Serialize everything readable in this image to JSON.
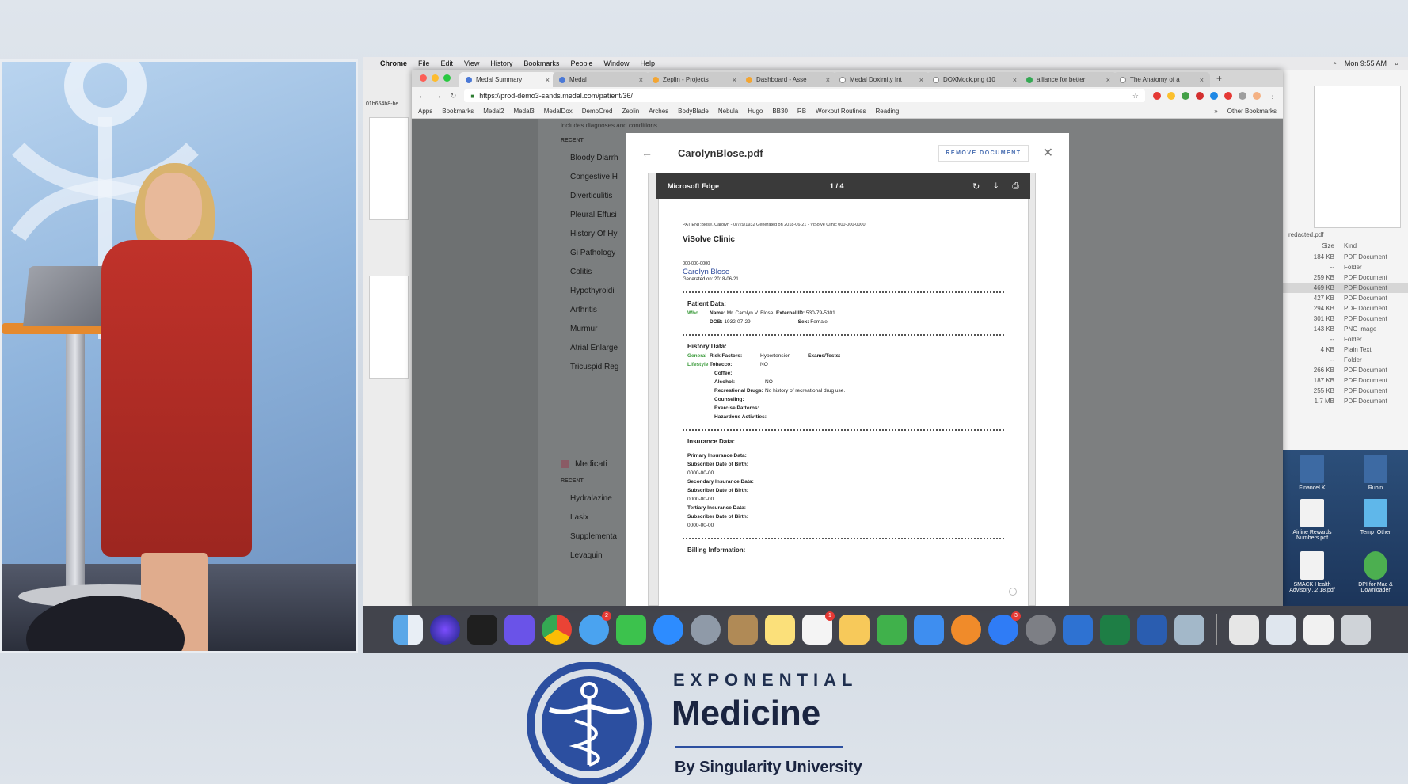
{
  "menubar": {
    "apple": "",
    "items": [
      "Chrome",
      "File",
      "Edit",
      "View",
      "History",
      "Bookmarks",
      "People",
      "Window",
      "Help"
    ],
    "clock": "Mon 9:55 AM"
  },
  "finder": {
    "left_label": "01b654b8-be",
    "preview_caption": "redacted.pdf",
    "rows": [
      {
        "size": "184 KB",
        "kind": "PDF Document"
      },
      {
        "size": "--",
        "kind": "Folder"
      },
      {
        "size": "259 KB",
        "kind": "PDF Document"
      },
      {
        "size": "469 KB",
        "kind": "PDF Document"
      },
      {
        "size": "427 KB",
        "kind": "PDF Document"
      },
      {
        "size": "294 KB",
        "kind": "PDF Document"
      },
      {
        "size": "301 KB",
        "kind": "PDF Document"
      },
      {
        "size": "143 KB",
        "kind": "PNG image"
      },
      {
        "size": "--",
        "kind": "Folder"
      },
      {
        "size": "4 KB",
        "kind": "Plain Text"
      },
      {
        "size": "--",
        "kind": "Folder"
      },
      {
        "size": "266 KB",
        "kind": "PDF Document"
      },
      {
        "size": "187 KB",
        "kind": "PDF Document"
      },
      {
        "size": "255 KB",
        "kind": "PDF Document"
      },
      {
        "size": "1.7 MB",
        "kind": "PDF Document"
      }
    ],
    "col_size": "Size",
    "col_kind": "Kind"
  },
  "desktop": {
    "icons": [
      {
        "label": "FinanceLK"
      },
      {
        "label": "Rubin"
      },
      {
        "label": "Airline Rewards Numbers.pdf"
      },
      {
        "label": "Temp_Other"
      },
      {
        "label": "SMACK Health Advisory...2.18.pdf"
      },
      {
        "label": "DPI for Mac & Downloader"
      }
    ]
  },
  "chrome": {
    "tabs": [
      {
        "label": "Medal Summary",
        "active": true
      },
      {
        "label": "Medal",
        "active": false
      },
      {
        "label": "Zeplin - Projects",
        "active": false
      },
      {
        "label": "Dashboard - Asse",
        "active": false
      },
      {
        "label": "Medal Doximity Int",
        "active": false
      },
      {
        "label": "DOXMock.png (10",
        "active": false
      },
      {
        "label": "alliance for better",
        "active": false
      },
      {
        "label": "The Anatomy of a",
        "active": false
      }
    ],
    "url": "https://prod-demo3-sands.medal.com/patient/36/",
    "bookmarks": [
      "Apps",
      "Bookmarks",
      "Medal2",
      "Medal3",
      "MedalDox",
      "DemoCred",
      "Zeplin",
      "Arches",
      "BodyBlade",
      "Nebula",
      "Hugo",
      "BB30",
      "RB",
      "Workout Routines",
      "Reading"
    ],
    "bookmarks_more": "»",
    "other_bookmarks": "Other Bookmarks"
  },
  "page": {
    "caption": "includes diagnoses and conditions",
    "recent_label": "RECENT",
    "conditions": [
      "Bloody Diarrh",
      "Congestive H",
      "Diverticulitis",
      "Pleural Effusi",
      "History Of Hy",
      "Gi Pathology",
      "Colitis",
      "Hypothyroidi",
      "Arthritis",
      "Murmur",
      "Atrial Enlarge",
      "Tricuspid Reg"
    ],
    "medications_title": "Medicati",
    "med_recent_label": "RECENT",
    "medications": [
      "Hydralazine",
      "Lasix",
      "Supplementa",
      "Levaquin"
    ]
  },
  "modal": {
    "title": "CarolynBlose.pdf",
    "remove_label": "REMOVE DOCUMENT",
    "viewer_brand": "Microsoft Edge",
    "page_indicator": "1 / 4",
    "pdf": {
      "meta": "PATIENT:Blose, Carolyn - 07/29/1932 Generated on 2018-06-21 - ViSolve Clinic 000-000-0000",
      "clinic": "ViSolve Clinic",
      "patient_id": "000-000-0000",
      "patient_name": "Carolyn Blose",
      "generated": "Generated on: 2018-06-21",
      "patient_data_title": "Patient Data:",
      "who_label": "Who",
      "name_label": "Name:",
      "name_value": "Mr. Carolyn V. Blose",
      "extid_label": "External ID:",
      "extid_value": "530-79-5301",
      "dob_label": "DOB:",
      "dob_value": "1932-07-29",
      "sex_label": "Sex:",
      "sex_value": "Female",
      "history_title": "History Data:",
      "general_label": "General",
      "risk_label": "Risk Factors:",
      "risk_value": "Hypertension",
      "exams_label": "Exams/Tests:",
      "lifestyle_label": "Lifestyle",
      "tobacco_label": "Tobacco:",
      "tobacco_value": "NO",
      "coffee_label": "Coffee:",
      "alcohol_label": "Alcohol:",
      "alcohol_value": "NO",
      "recdrugs_label": "Recreational Drugs:",
      "recdrugs_value": "No history of recreational drug use.",
      "counseling_label": "Counseling:",
      "exercise_label": "Exercise Patterns:",
      "hazard_label": "Hazardous Activities:",
      "insurance_title": "Insurance Data:",
      "primary_label": "Primary Insurance Data:",
      "secondary_label": "Secondary Insurance Data:",
      "tertiary_label": "Tertiary Insurance Data:",
      "subscriber_dob_label": "Subscriber Date of Birth:",
      "subscriber_dob_value": "0000-00-00",
      "billing_title": "Billing Information:"
    }
  },
  "branding": {
    "line1": "EXPONENTIAL",
    "line2": "Medicine",
    "line3": "By Singularity University",
    "primary_color": "#2c4fa0"
  }
}
